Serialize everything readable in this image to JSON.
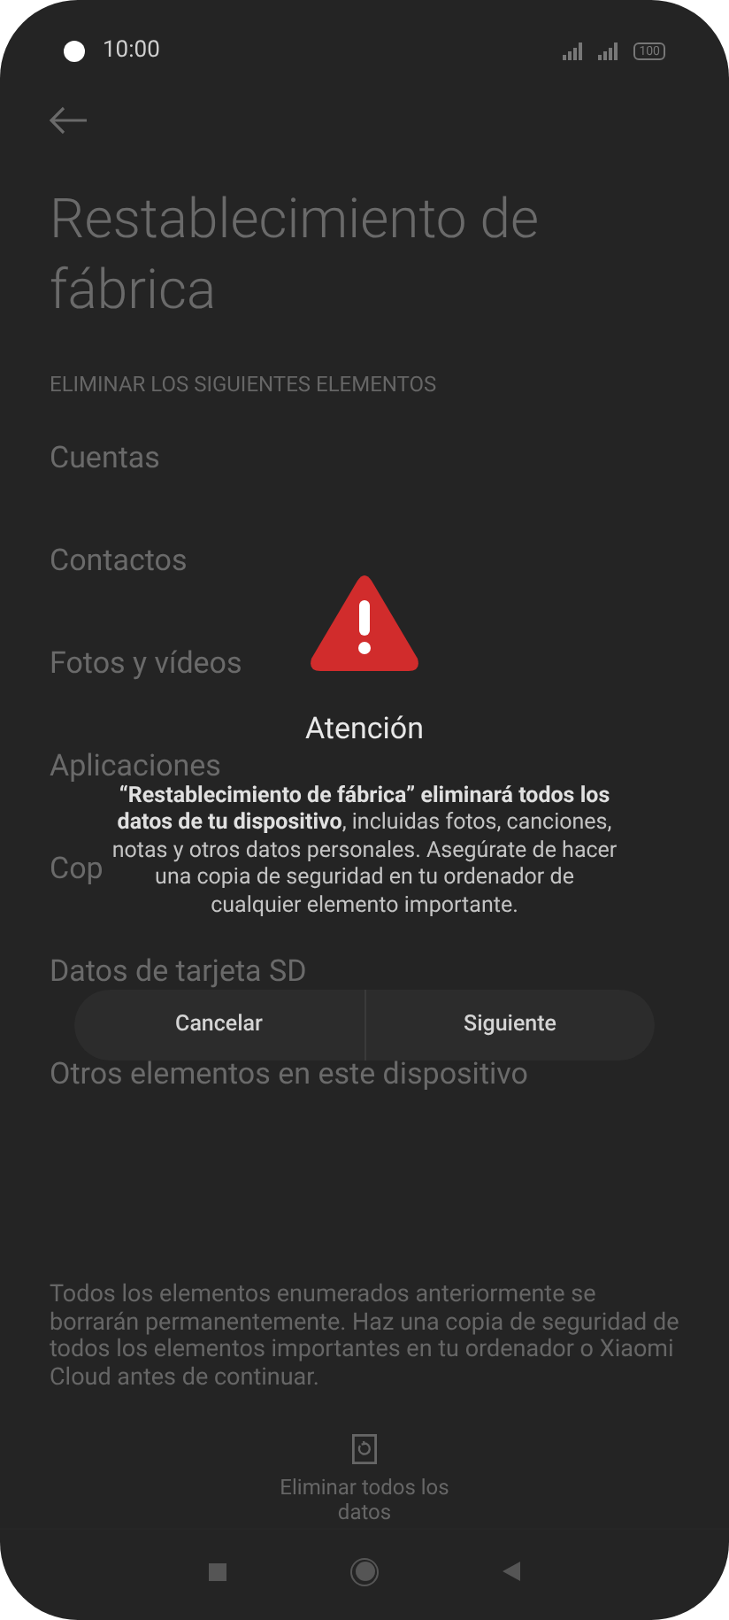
{
  "status_bar": {
    "time": "10:00",
    "battery": "100"
  },
  "page": {
    "title": "Restablecimiento de fábrica",
    "section_header": "ELIMINAR LOS SIGUIENTES ELEMENTOS",
    "items": [
      "Cuentas",
      "Contactos",
      "Fotos y vídeos",
      "Aplicaciones",
      "Cop",
      "Datos de tarjeta SD",
      "Otros elementos en este dispositivo"
    ],
    "note": "Todos los elementos enumerados anteriormente se borrarán permanentemente. Haz una copia de seguridad de todos los elementos importantes en tu ordenador o Xiaomi Cloud antes de continuar.",
    "erase_button": "Eliminar todos los datos"
  },
  "dialog": {
    "title": "Atención",
    "message": "**“Restablecimiento de fábrica” eliminará todos los datos de tu dispositivo**, incluidas fotos, canciones, notas y otros datos personales. Asegúrate de hacer una copia de seguridad en tu ordenador de cualquier elemento importante.",
    "buttons": [
      "Cancelar",
      "Siguiente"
    ]
  }
}
